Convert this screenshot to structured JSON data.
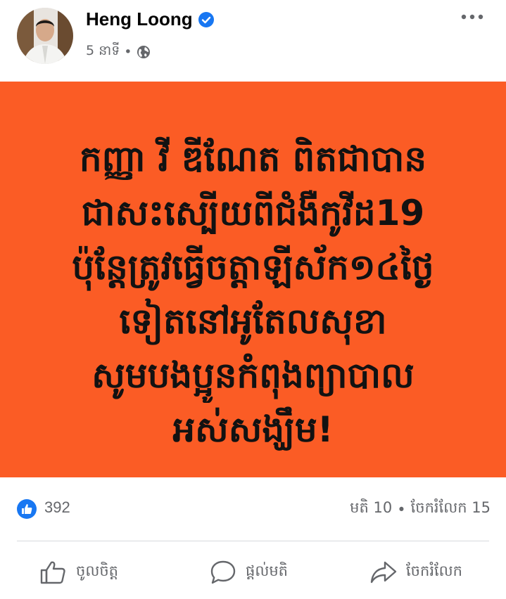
{
  "post": {
    "author": "Heng Loong",
    "time": "5 នាទី",
    "separator": "•",
    "privacy_icon": "globe-icon",
    "verified_icon": "verified-badge-icon"
  },
  "banner": {
    "background": "#fb5c25",
    "text_color": "#121212",
    "lines": [
      "កញ្ញា វី ឌីណែត ពិតជាបាន",
      "ជាសះស្បើយពីជំងឺកូវីដ19",
      "ប៉ុន្តែត្រូវធ្វើចត្តាឡីស័ក១៤ថ្ងៃ",
      "ទៀតនៅអូតែលសុខា",
      "សូមបងប្អូនកំពុងព្យាបាល",
      "អស់សង្ឃឹម!"
    ]
  },
  "reactions": {
    "like_count": "392",
    "comments": "មតិ 10",
    "dot": "•",
    "shares": "ចែករំលែក 15",
    "like_color": "#1877f2"
  },
  "actions": {
    "like": "ចូលចិត្ត",
    "comment": "ផ្ដល់មតិ",
    "share": "ចែករំលែក"
  }
}
